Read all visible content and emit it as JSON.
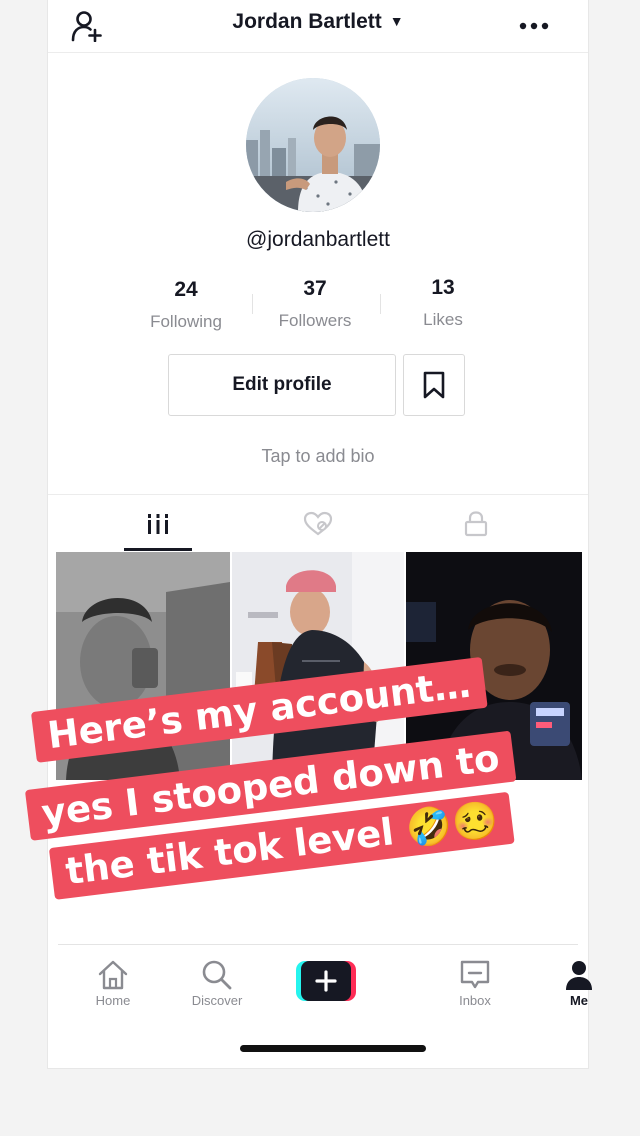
{
  "header": {
    "username": "Jordan Bartlett",
    "add_user_icon": "person-add-icon",
    "menu_icon": "more-horizontal-icon"
  },
  "profile": {
    "handle": "@jordanbartlett",
    "stats": [
      {
        "value": "24",
        "label": "Following"
      },
      {
        "value": "37",
        "label": "Followers"
      },
      {
        "value": "13",
        "label": "Likes"
      }
    ],
    "edit_profile_label": "Edit profile",
    "bookmark_icon": "bookmark-icon",
    "bio_placeholder": "Tap to add bio"
  },
  "tabs": [
    {
      "icon": "grid-icon",
      "active": true
    },
    {
      "icon": "liked-icon",
      "active": false
    },
    {
      "icon": "lock-icon",
      "active": false
    }
  ],
  "videos": [
    {
      "tone": "dark-gray"
    },
    {
      "tone": "light"
    },
    {
      "tone": "night"
    }
  ],
  "caption_overlay": {
    "line1": "Here’s my account…",
    "line2": "yes I stooped down to",
    "line3": "the tik tok level 🤣🥴"
  },
  "bottom_nav": [
    {
      "label": "Home",
      "icon": "home-icon",
      "active": false
    },
    {
      "label": "Discover",
      "icon": "search-icon",
      "active": false
    },
    {
      "label": "",
      "icon": "plus-icon",
      "active": false
    },
    {
      "label": "Inbox",
      "icon": "inbox-icon",
      "active": false
    },
    {
      "label": "Me",
      "icon": "person-icon",
      "active": true
    }
  ],
  "colors": {
    "caption_bg": "#ee4e5e",
    "text_primary": "#161823",
    "text_secondary": "#8a8b91",
    "plus_cyan": "#25f4ee",
    "plus_red": "#fe2c55"
  }
}
